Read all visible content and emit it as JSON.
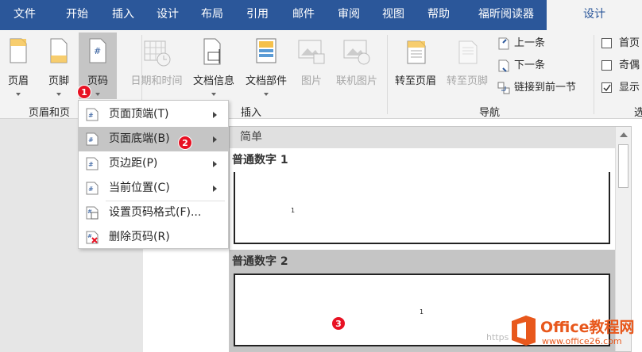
{
  "tabs": [
    {
      "label": "文件"
    },
    {
      "label": "开始"
    },
    {
      "label": "插入"
    },
    {
      "label": "设计"
    },
    {
      "label": "布局"
    },
    {
      "label": "引用"
    },
    {
      "label": "邮件"
    },
    {
      "label": "审阅"
    },
    {
      "label": "视图"
    },
    {
      "label": "帮助"
    },
    {
      "label": "福昕阅读器"
    },
    {
      "label": "设计"
    }
  ],
  "ribbon": {
    "header": "页眉",
    "footer": "页脚",
    "page_number": "页码",
    "date_time": "日期和时间",
    "doc_info": "文档信息",
    "doc_parts": "文档部件",
    "picture": "图片",
    "online_picture": "联机图片",
    "goto_header": "转至页眉",
    "goto_footer": "转至页脚",
    "previous": "上一条",
    "next": "下一条",
    "link_prev": "链接到前一节",
    "first_page": "首页",
    "odd_even": "奇偶",
    "show": "显示",
    "group_hf": "页眉和页",
    "group_insert": "插入",
    "group_nav": "导航",
    "group_opt": "选"
  },
  "badges": {
    "one": "1",
    "two": "2",
    "three": "3"
  },
  "menu": {
    "items": [
      {
        "label": "页面顶端(T)"
      },
      {
        "label": "页面底端(B)"
      },
      {
        "label": "页边距(P)"
      },
      {
        "label": "当前位置(C)"
      },
      {
        "label": "设置页码格式(F)..."
      },
      {
        "label": "删除页码(R)"
      }
    ]
  },
  "gallery": {
    "section": "简单",
    "items": [
      {
        "title": "普通数字 1",
        "sample": "1"
      },
      {
        "title": "普通数字 2",
        "sample": "1"
      }
    ]
  },
  "watermark": {
    "brand": "Office教程网",
    "url": "www.office26.com",
    "faint": "https"
  },
  "colors": {
    "ribbon_blue": "#2b579a",
    "badge_red": "#e81123",
    "logo_orange": "#e8581c"
  }
}
